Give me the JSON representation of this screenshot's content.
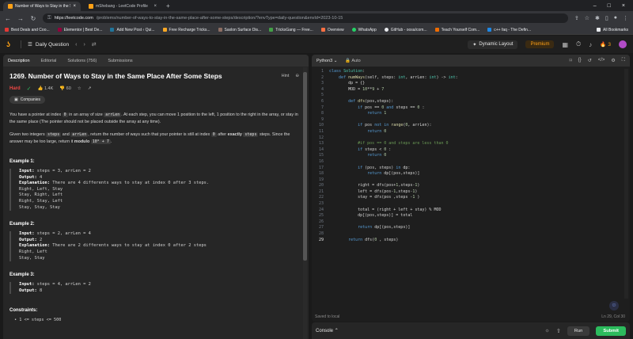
{
  "browser": {
    "tabs": [
      {
        "title": "Number of Ways to Stay in the S",
        "active": true
      },
      {
        "title": "mShebang - LeetCode Profile",
        "active": false
      }
    ],
    "url_host": "https://leetcode.com",
    "url_path": "/problems/number-of-ways-to-stay-in-the-same-place-after-some-steps/description/?envType=daily-question&envId=2023-10-15",
    "bookmarks": [
      {
        "label": "Best Deals and Coo...",
        "color": "#e53935"
      },
      {
        "label": "Elementor | Best De...",
        "color": "#92003b"
      },
      {
        "label": "Add New Post ‹ Qui...",
        "color": "#21759b"
      },
      {
        "label": "Free Recharge Tricks...",
        "color": "#f9a825"
      },
      {
        "label": "Saxlon Surface Dis...",
        "color": "#8d6e63"
      },
      {
        "label": "TricksGang — Free...",
        "color": "#43a047"
      },
      {
        "label": "Overview",
        "color": "#ff7043"
      },
      {
        "label": "WhatsApp",
        "color": "#25d366"
      },
      {
        "label": "GitHub - oosa/com...",
        "color": "#e8eaed"
      },
      {
        "label": "Teach Yourself Com...",
        "color": "#ef6c00"
      },
      {
        "label": "c++ faq - The Defin...",
        "color": "#1e88e5"
      }
    ],
    "all_bookmarks": "All Bookmarks"
  },
  "nav": {
    "daily_question": "Daily Question",
    "dynamic_layout": "Dynamic Layout",
    "premium": "Premium",
    "streak": "3"
  },
  "left": {
    "tabs": [
      "Description",
      "Editorial",
      "Solutions (756)",
      "Submissions"
    ],
    "title": "1269. Number of Ways to Stay in the Same Place After Some Steps",
    "hint": "Hint",
    "difficulty": "Hard",
    "likes": "1.4K",
    "dislikes": "60",
    "companies": "Companies",
    "p1_a": "You have a pointer at index ",
    "p1_code1": "0",
    "p1_b": " in an array of size ",
    "p1_code2": "arrLen",
    "p1_c": ". At each step, you can move 1 position to the left, 1 position to the right in the array, or stay in the same place (The pointer should not be placed outside the array at any time).",
    "p2_a": "Given two integers ",
    "p2_code1": "steps",
    "p2_b": " and ",
    "p2_code2": "arrLen",
    "p2_c": ", return the number of ways such that your pointer is still at index ",
    "p2_code3": "0",
    "p2_d": " after ",
    "p2_exactly": "exactly",
    "p2_code4": "steps",
    "p2_e": " steps. Since the answer may be too large, return it ",
    "p2_modulo": "modulo",
    "p2_code5": "10⁹ + 7",
    "p2_f": ".",
    "examples": [
      {
        "heading": "Example 1:",
        "input": "steps = 3, arrLen = 2",
        "output": "4",
        "explanation": "There are 4 differents ways to stay at index 0 after 3 steps.",
        "lines": [
          "Right, Left, Stay",
          "Stay, Right, Left",
          "Right, Stay, Left",
          "Stay, Stay, Stay"
        ]
      },
      {
        "heading": "Example 2:",
        "input": "steps = 2, arrLen = 4",
        "output": "2",
        "explanation": "There are 2 differents ways to stay at index 0 after 2 steps",
        "lines": [
          "Right, Left",
          "Stay, Stay"
        ]
      },
      {
        "heading": "Example 3:",
        "input": "steps = 4, arrLen = 2",
        "output": "8"
      }
    ],
    "labels": {
      "input": "Input:",
      "output": "Output:",
      "explanation": "Explanation:"
    },
    "constraints_heading": "Constraints:",
    "constraint1": "1 <= steps <= 500"
  },
  "editor": {
    "language": "Python3",
    "auto": "Auto",
    "saved": "Saved to local",
    "position": "Ln 29, Col 30"
  },
  "console": {
    "label": "Console",
    "run": "Run",
    "submit": "Submit"
  }
}
